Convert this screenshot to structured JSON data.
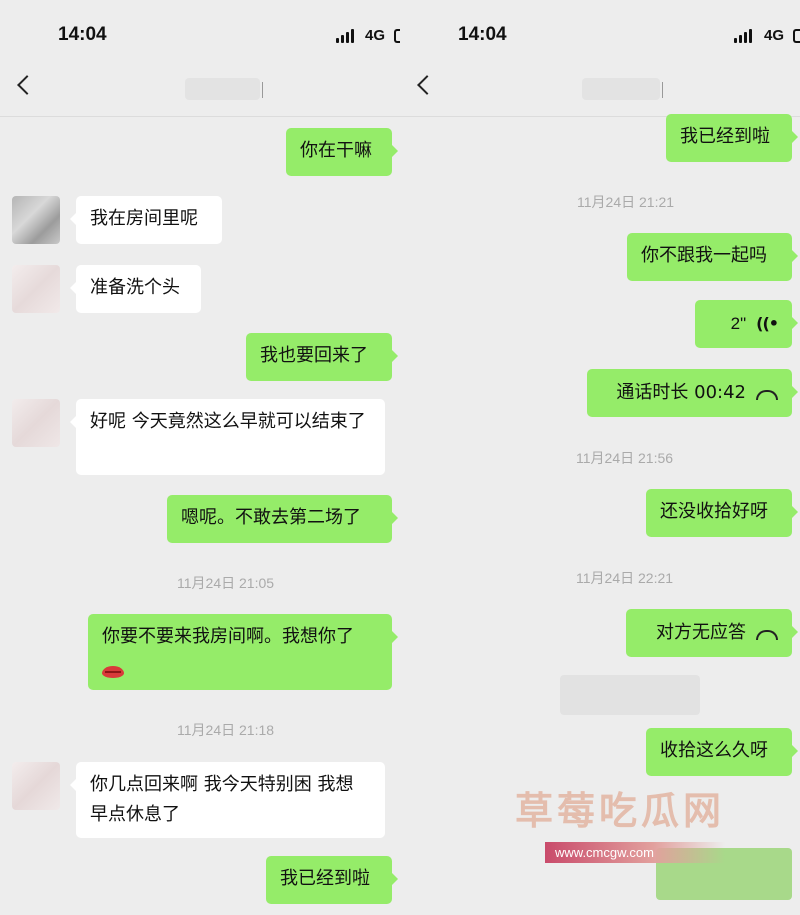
{
  "status": {
    "time": "14:04",
    "network": "4G"
  },
  "left": {
    "messages": [
      {
        "text": "你在干嘛"
      },
      {
        "text": "我在房间里呢"
      },
      {
        "text": "准备洗个头"
      },
      {
        "text": "我也要回来了"
      },
      {
        "text": "好呢 今天竟然这么早就可以结束了"
      },
      {
        "text": "嗯呢。不敢去第二场了"
      },
      {
        "text": "你要不要来我房间啊。我想你了"
      },
      {
        "text": "你几点回来啊 我今天特别困 我想早点休息了"
      },
      {
        "text": "我已经到啦"
      }
    ],
    "timestamps": [
      "11月24日 21:05",
      "11月24日 21:18"
    ]
  },
  "right": {
    "messages": [
      {
        "text": "我已经到啦"
      },
      {
        "text": "你不跟我一起吗"
      },
      {
        "text": "2\""
      },
      {
        "text": "通话时长 00:42"
      },
      {
        "text": "还没收拾好呀"
      },
      {
        "text": "对方无应答"
      },
      {
        "text": "收拾这么久呀"
      }
    ],
    "timestamps": [
      "11月24日 21:21",
      "11月24日 21:56",
      "11月24日 22:21"
    ]
  },
  "watermark": {
    "text": "草莓吃瓜网",
    "url": "www.cmcgw.com"
  },
  "icons": {
    "back": "chevron-left-icon",
    "call": "phone-hangup-icon",
    "voice": "voice-wave-icon",
    "kiss": "lips-emoji-icon"
  },
  "colors": {
    "background": "#ededed",
    "green_bubble": "#95ec69",
    "white_bubble": "#ffffff"
  }
}
